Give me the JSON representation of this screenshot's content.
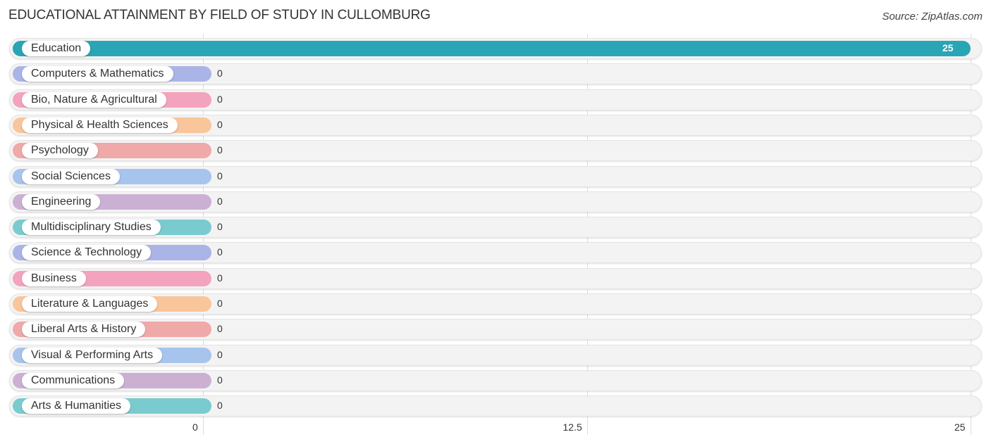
{
  "chart_data": {
    "type": "bar",
    "orientation": "horizontal",
    "title": "EDUCATIONAL ATTAINMENT BY FIELD OF STUDY IN CULLOMBURG",
    "source": "Source: ZipAtlas.com",
    "xlabel": "",
    "ylabel": "",
    "xlim": [
      0,
      25
    ],
    "xticks": [
      "0",
      "12.5",
      "25"
    ],
    "xtick_values": [
      0,
      12.5,
      25
    ],
    "grid": true,
    "categories": [
      "Education",
      "Computers & Mathematics",
      "Bio, Nature & Agricultural",
      "Physical & Health Sciences",
      "Psychology",
      "Social Sciences",
      "Engineering",
      "Multidisciplinary Studies",
      "Science & Technology",
      "Business",
      "Literature & Languages",
      "Liberal Arts & History",
      "Visual & Performing Arts",
      "Communications",
      "Arts & Humanities"
    ],
    "values": [
      25,
      0,
      0,
      0,
      0,
      0,
      0,
      0,
      0,
      0,
      0,
      0,
      0,
      0,
      0
    ],
    "value_labels": [
      "25",
      "0",
      "0",
      "0",
      "0",
      "0",
      "0",
      "0",
      "0",
      "0",
      "0",
      "0",
      "0",
      "0",
      "0"
    ],
    "colors": [
      "#29a5b5",
      "#aab4e6",
      "#f4a3bf",
      "#f9c59b",
      "#efa9a8",
      "#a7c4ec",
      "#cbb0d4",
      "#79cbcf",
      "#aab4e6",
      "#f4a3bf",
      "#f9c59b",
      "#efa9a8",
      "#a7c4ec",
      "#cbb0d4",
      "#79cbcf"
    ]
  }
}
